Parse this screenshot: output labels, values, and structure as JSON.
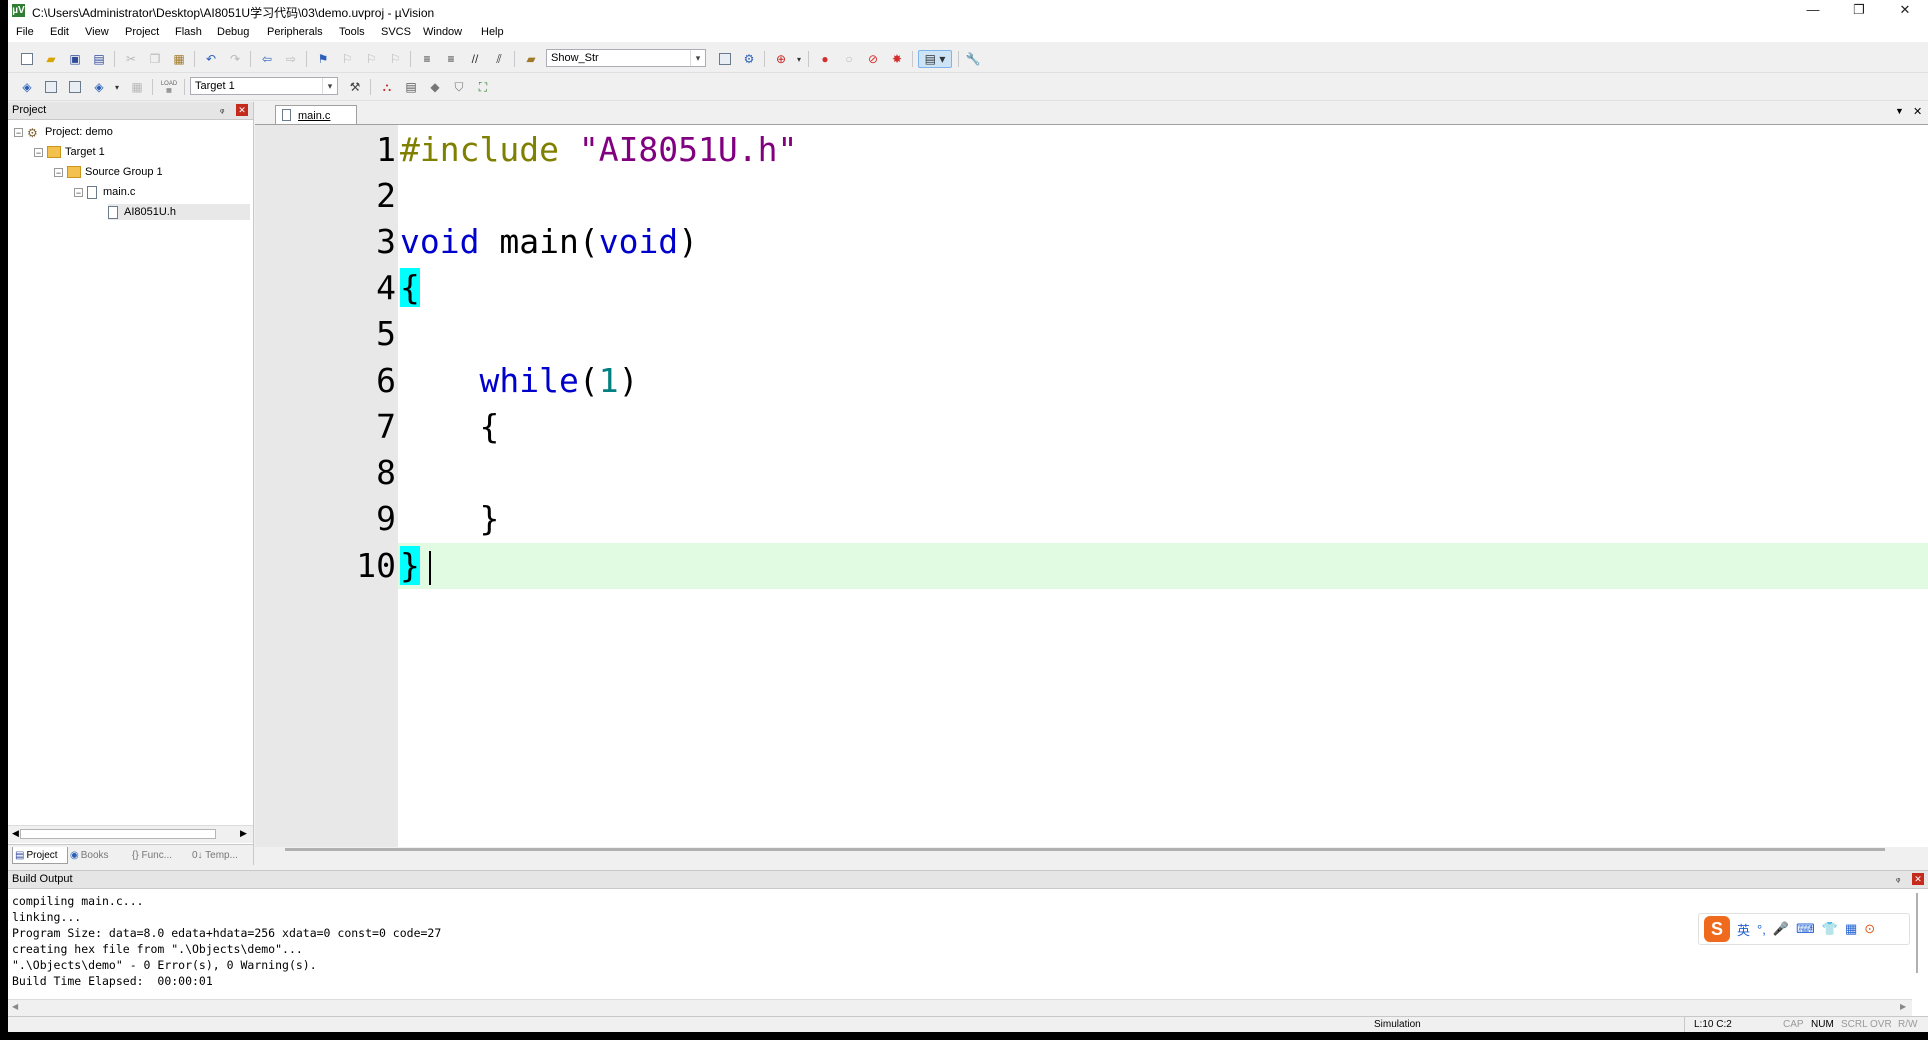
{
  "window": {
    "title": "C:\\Users\\Administrator\\Desktop\\AI8051U学习代码\\03\\demo.uvproj - µVision",
    "app_icon": "µV",
    "minimize_glyph": "—",
    "maximize_glyph": "❐",
    "close_glyph": "✕"
  },
  "menu": {
    "file": "File",
    "edit": "Edit",
    "view": "View",
    "project": "Project",
    "flash": "Flash",
    "debug": "Debug",
    "peripherals": "Peripherals",
    "tools": "Tools",
    "svcs": "SVCS",
    "window": "Window",
    "help": "Help"
  },
  "toolbar": {
    "find_combo_value": "Show_Str",
    "target_combo_value": "Target 1",
    "load_label": "LOAD"
  },
  "project_panel": {
    "title": "Project",
    "pin": "ᵩ",
    "close": "✕",
    "tree": {
      "project": "Project: demo",
      "target": "Target 1",
      "group": "Source Group 1",
      "file": "main.c",
      "include": "AI8051U.h"
    },
    "tabs": {
      "project": "Project",
      "books": "Books",
      "functions": "{} Func...",
      "templates": "0↓ Temp..."
    }
  },
  "editor": {
    "tab_label": "main.c",
    "dropdown_glyph": "▼",
    "close_glyph": "✕",
    "line_numbers": [
      "1",
      "2",
      "3",
      "4",
      "5",
      "6",
      "7",
      "8",
      "9",
      "10"
    ],
    "code": {
      "l1_pp": "#include",
      "l1_str": "\"AI8051U.h\"",
      "l3_kw1": "void",
      "l3_fn": " main(",
      "l3_kw2": "void",
      "l3_end": ")",
      "l4": "{",
      "l6_kw": "while",
      "l6_open": "(",
      "l6_num": "1",
      "l6_close": ")",
      "l7": "{",
      "l9": "}",
      "l10": "}"
    }
  },
  "build_output": {
    "title": "Build Output",
    "lines": "compiling main.c...\nlinking...\nProgram Size: data=8.0 edata+hdata=256 xdata=0 const=0 code=27\ncreating hex file from \".\\Objects\\demo\"...\n\".\\Objects\\demo\" - 0 Error(s), 0 Warning(s).\nBuild Time Elapsed:  00:00:01",
    "ime": {
      "logo": "S",
      "lang": "英",
      "punct": "°,",
      "mic": "🎤",
      "keyboard": "⌨",
      "skin": "👕",
      "apps": "▦",
      "menu": "⊙"
    }
  },
  "status_bar": {
    "mode": "Simulation",
    "position": "L:10 C:2",
    "cap": "CAP",
    "num": "NUM",
    "scrl": "SCRL",
    "ovr": "OVR",
    "rw": "R/W"
  }
}
